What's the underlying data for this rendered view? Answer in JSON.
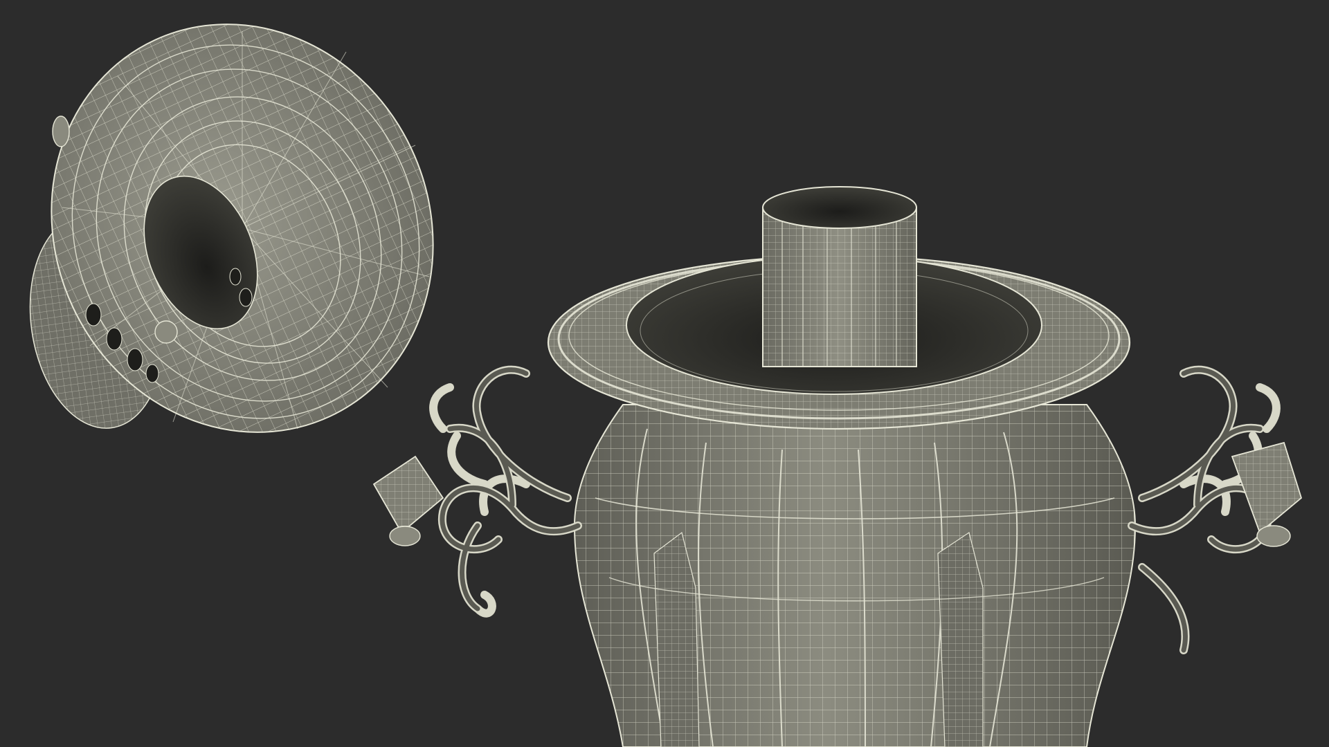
{
  "viewport": {
    "background": "#2c2c2c",
    "mesh_fill_light": "#8a8a7e",
    "mesh_fill_dark": "#5d5d54",
    "wire_color": "#e6e6d6",
    "shadow_color": "#1e1e1b"
  },
  "objects": [
    {
      "name": "samovar-lid-wireframe"
    },
    {
      "name": "samovar-body-wireframe"
    },
    {
      "name": "chimney-pipe-wireframe"
    },
    {
      "name": "left-ornate-handle-wireframe"
    },
    {
      "name": "right-ornate-handle-wireframe"
    }
  ]
}
